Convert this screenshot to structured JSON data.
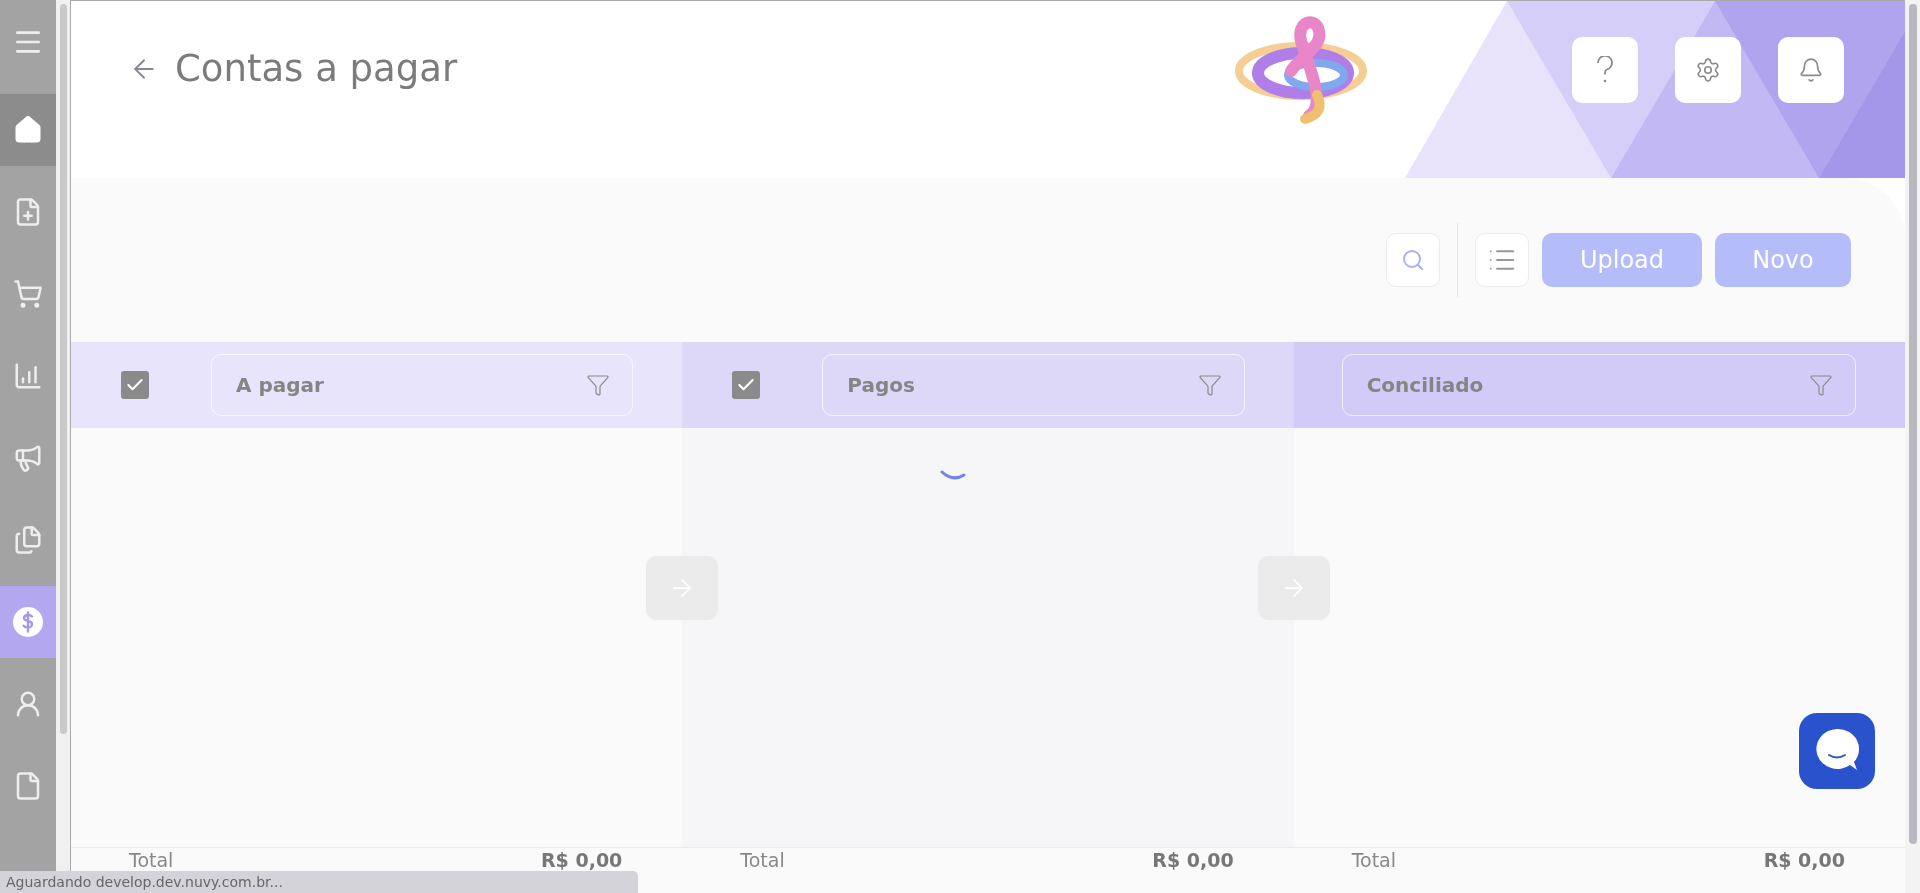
{
  "sidebar": {
    "items": [
      {
        "selected": true
      },
      {
        "selected": false
      },
      {
        "selected": false
      },
      {
        "selected": false
      },
      {
        "selected": false
      },
      {
        "selected": false
      },
      {
        "selected": true
      },
      {
        "selected": false
      },
      {
        "selected": false
      }
    ]
  },
  "header": {
    "title": "Contas a pagar"
  },
  "toolbar": {
    "buttons": [
      "Upload",
      "Novo"
    ]
  },
  "columns": [
    {
      "label": "A pagar",
      "checked": true,
      "color": "#e8e4fb",
      "total_label": "Total",
      "total_value": "R$ 0,00"
    },
    {
      "label": "Pagos",
      "checked": true,
      "color": "#ddd8f8",
      "total_label": "Total",
      "total_value": "R$ 0,00",
      "loading": true
    },
    {
      "label": "Conciliado",
      "color": "#d2cbf8",
      "total_label": "Total",
      "total_value": "R$ 0,00"
    }
  ],
  "status_bar": "Aguardando develop.dev.nuvy.com.br..."
}
